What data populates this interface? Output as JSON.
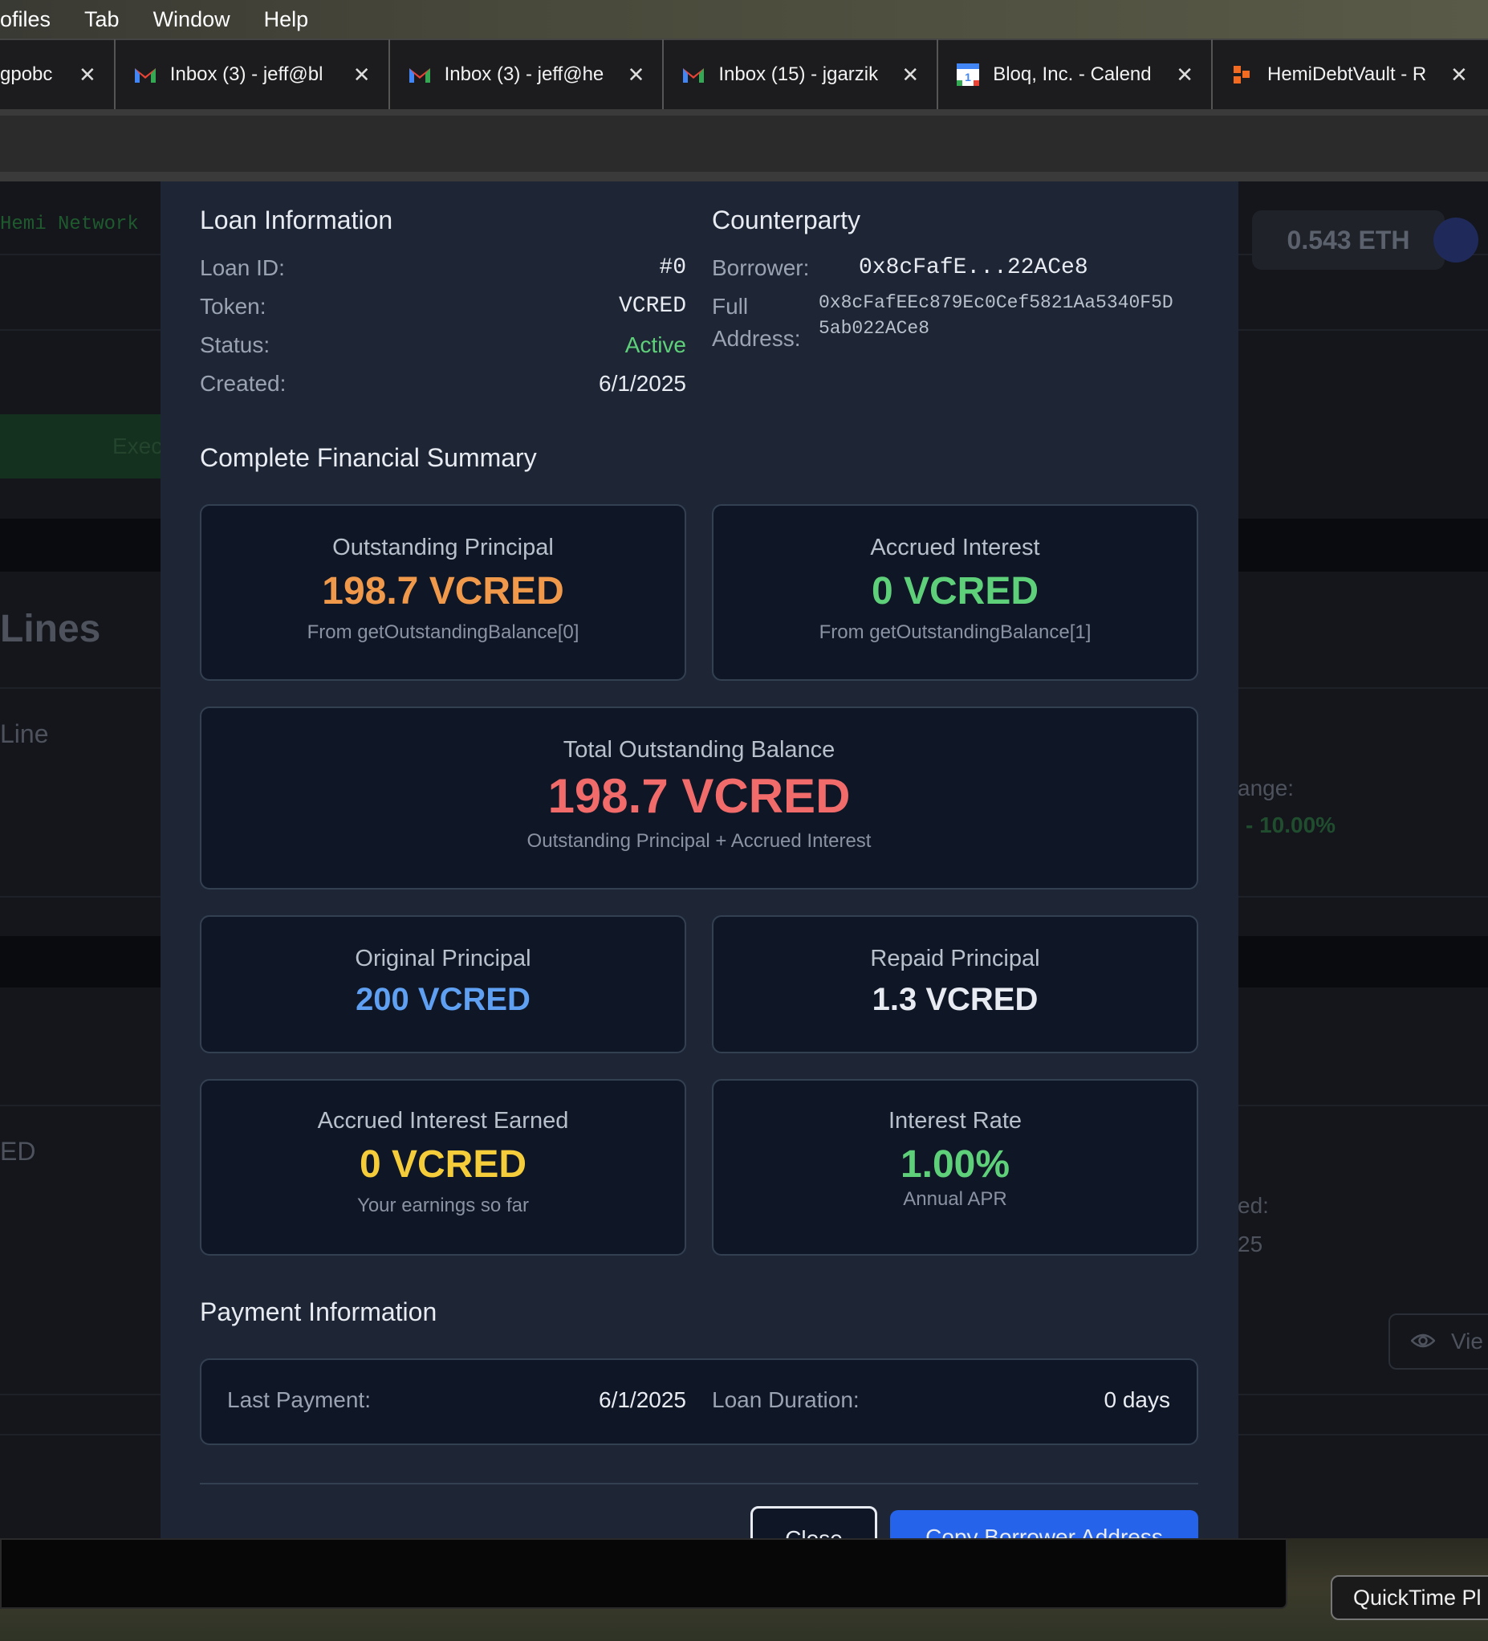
{
  "menubar": {
    "items": [
      "ofiles",
      "Tab",
      "Window",
      "Help"
    ]
  },
  "tabs": [
    {
      "label": "gpobc",
      "icon": "none"
    },
    {
      "label": "Inbox (3) - jeff@bl",
      "icon": "gmail-icon"
    },
    {
      "label": "Inbox (3) - jeff@he",
      "icon": "gmail-icon"
    },
    {
      "label": "Inbox (15) - jgarzik",
      "icon": "gmail-icon"
    },
    {
      "label": "Bloq, Inc. - Calend",
      "icon": "calendar-icon"
    },
    {
      "label": "HemiDebtVault - R",
      "icon": "hemi-icon"
    }
  ],
  "background": {
    "network": "Hemi Network",
    "exec": "Exec",
    "lines": "Lines",
    "line": "Line",
    "ed": "ED",
    "eth": "0.543 ETH",
    "ange": "ange:",
    "pct": "- 10.00%",
    "ed2": "ed:",
    "d25": "25",
    "view": "Vie"
  },
  "loan_info": {
    "title": "Loan Information",
    "rows": [
      {
        "label": "Loan ID:",
        "value": "#0"
      },
      {
        "label": "Token:",
        "value": "VCRED"
      },
      {
        "label": "Status:",
        "value": "Active"
      },
      {
        "label": "Created:",
        "value": "6/1/2025"
      }
    ]
  },
  "counterparty": {
    "title": "Counterparty",
    "borrower_label": "Borrower:",
    "borrower_value": "0x8cFafE...22ACe8",
    "full_label_1": "Full",
    "full_label_2": "Address:",
    "full_value_1": "0x8cFafEEc879Ec0Cef5821Aa5340F5D",
    "full_value_2": "5ab022ACe8"
  },
  "summary": {
    "title": "Complete Financial Summary",
    "outstanding_principal": {
      "title": "Outstanding Principal",
      "value": "198.7 VCRED",
      "sub": "From getOutstandingBalance[0]"
    },
    "accrued_interest": {
      "title": "Accrued Interest",
      "value": "0 VCRED",
      "sub": "From getOutstandingBalance[1]"
    },
    "total": {
      "title": "Total Outstanding Balance",
      "value": "198.7 VCRED",
      "sub": "Outstanding Principal + Accrued Interest"
    },
    "original_principal": {
      "title": "Original Principal",
      "value": "200 VCRED"
    },
    "repaid_principal": {
      "title": "Repaid Principal",
      "value": "1.3 VCRED"
    },
    "interest_earned": {
      "title": "Accrued Interest Earned",
      "value": "0 VCRED",
      "sub": "Your earnings so far"
    },
    "interest_rate": {
      "title": "Interest Rate",
      "value": "1.00%",
      "sub": "Annual APR"
    }
  },
  "payment": {
    "title": "Payment Information",
    "last_payment_label": "Last Payment:",
    "last_payment_value": "6/1/2025",
    "duration_label": "Loan Duration:",
    "duration_value": "0 days"
  },
  "buttons": {
    "close": "Close",
    "copy": "Copy Borrower Address"
  },
  "colors": {
    "orange": "#f0994a",
    "green": "#5fd07a",
    "red": "#f26b6b",
    "blue": "#5fa0f2",
    "yellow": "#f5cc3a",
    "primary_button": "#2563eb"
  },
  "tooltip": "QuickTime Pl"
}
